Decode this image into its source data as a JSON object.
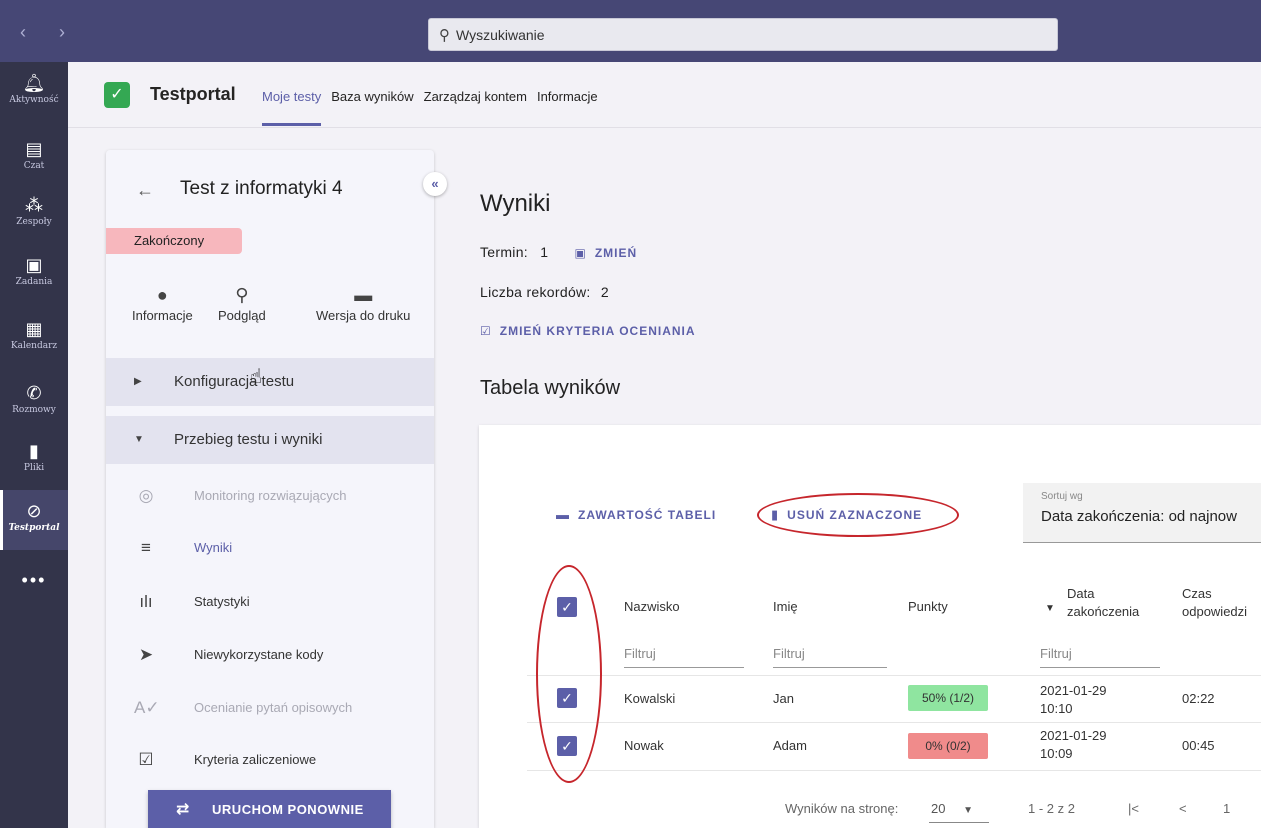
{
  "titlebar": {
    "search_placeholder": "Wyszukiwanie",
    "nav": "‹ ›"
  },
  "rail": {
    "items": [
      {
        "label": "Aktywność",
        "icon": "bell-icon"
      },
      {
        "label": "Czat",
        "icon": "chat-icon"
      },
      {
        "label": "Zespoły",
        "icon": "teams-icon"
      },
      {
        "label": "Zadania",
        "icon": "assignments-icon"
      },
      {
        "label": "Kalendarz",
        "icon": "calendar-icon"
      },
      {
        "label": "Rozmowy",
        "icon": "phone-icon"
      },
      {
        "label": "Pliki",
        "icon": "file-icon"
      },
      {
        "label": "Testportal",
        "icon": "testportal-icon"
      }
    ],
    "more": "•••"
  },
  "appbar": {
    "brand": "Testportal",
    "tabs": [
      "Moje testy",
      "Baza wyników",
      "Zarządzaj kontem",
      "Informacje"
    ],
    "active_tab": "Moje testy"
  },
  "panel": {
    "title": "Test z informatyki 4",
    "status": "Zakończony",
    "tools": [
      "Informacje",
      "Podgląd",
      "Wersja do druku"
    ],
    "sections": [
      "Konfiguracja testu",
      "Przebieg testu i wyniki"
    ],
    "menu": [
      {
        "label": "Monitoring rozwiązujących",
        "icon": "monitoring-icon",
        "disabled": true
      },
      {
        "label": "Wyniki",
        "icon": "list-icon",
        "active": true
      },
      {
        "label": "Statystyki",
        "icon": "bar-chart-icon"
      },
      {
        "label": "Niewykorzystane kody",
        "icon": "send-icon"
      },
      {
        "label": "Ocenianie pytań opisowych",
        "icon": "spellcheck-icon",
        "disabled": true
      },
      {
        "label": "Kryteria zaliczeniowe",
        "icon": "clipboard-check-icon"
      }
    ],
    "restart_label": "URUCHOM PONOWNIE"
  },
  "main": {
    "title": "Wyniki",
    "term_label": "Termin:",
    "term_value": "1",
    "change_label": "ZMIEŃ",
    "records_label": "Liczba rekordów:",
    "records_value": "2",
    "criteria_label": "ZMIEŃ KRYTERIA OCENIANIA",
    "table_title": "Tabela wyników"
  },
  "table": {
    "toolbar": {
      "content_label": "ZAWARTOŚĆ TABELI",
      "delete_label": "USUŃ ZAZNACZONE"
    },
    "sort": {
      "label": "Sortuj wg",
      "value": "Data zakończenia: od najnow"
    },
    "headers": {
      "surname": "Nazwisko",
      "name": "Imię",
      "points": "Punkty",
      "date_line1": "Data",
      "date_line2": "zakończenia",
      "time_line1": "Czas",
      "time_line2": "odpowiedzi"
    },
    "filter_placeholder": "Filtruj",
    "rows": [
      {
        "surname": "Kowalski",
        "name": "Jan",
        "points": "50% (1/2)",
        "date1": "2021-01-29",
        "date2": "10:10",
        "time": "02:22",
        "status_color": "#8fe5a0"
      },
      {
        "surname": "Nowak",
        "name": "Adam",
        "points": "0% (0/2)",
        "date1": "2021-01-29",
        "date2": "10:09",
        "time": "00:45",
        "status_color": "#f08b8b"
      }
    ],
    "pagination": {
      "per_page_label": "Wyników na stronę:",
      "per_page": "20",
      "range": "1 - 2 z 2",
      "first": "|<",
      "prev": "<",
      "page": "1"
    }
  }
}
